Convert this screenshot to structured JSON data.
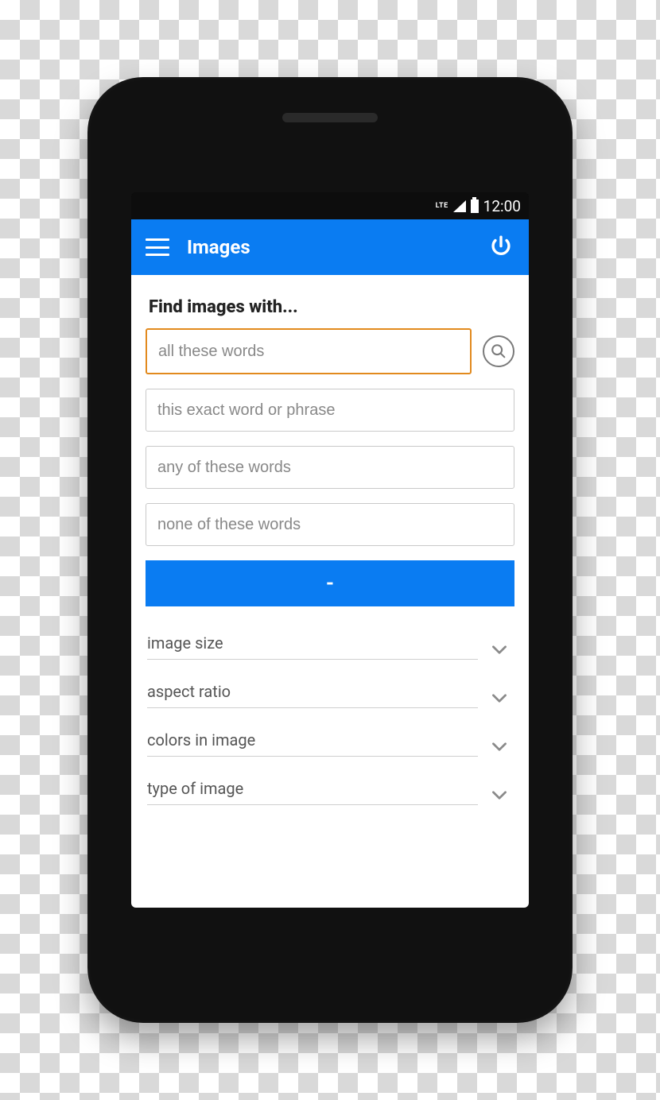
{
  "statusbar": {
    "network": "LTE",
    "time": "12:00"
  },
  "appbar": {
    "title": "Images"
  },
  "content": {
    "heading": "Find images with...",
    "inputs": {
      "all_words": "all these words",
      "exact_phrase": "this exact word or phrase",
      "any_words": "any of these words",
      "none_words": "none of these words"
    },
    "collapse_label": "-",
    "dropdowns": {
      "size": "image size",
      "aspect": "aspect ratio",
      "colors": "colors in image",
      "type": "type of image"
    }
  }
}
